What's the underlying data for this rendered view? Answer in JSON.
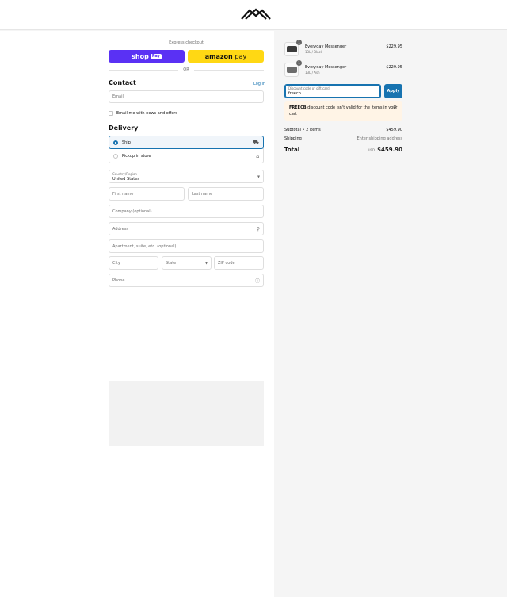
{
  "express": {
    "label": "Express checkout",
    "shop_pay": {
      "brand": "shop",
      "badge": "Pay",
      "color": "#5a31f4"
    },
    "amazon_pay": {
      "brand": "amazon",
      "suffix": "pay",
      "color": "#ffd814"
    },
    "or_label": "OR"
  },
  "contact": {
    "heading": "Contact",
    "login_link": "Log in",
    "email_placeholder": "Email",
    "newsletter_label": "Email me with news and offers"
  },
  "delivery": {
    "heading": "Delivery",
    "options": [
      {
        "label": "Ship",
        "selected": true,
        "icon": "truck-icon"
      },
      {
        "label": "Pickup in store",
        "selected": false,
        "icon": "store-icon"
      }
    ],
    "country_label": "Country/Region",
    "country_value": "United States",
    "first_name_placeholder": "First name",
    "last_name_placeholder": "Last name",
    "company_placeholder": "Company (optional)",
    "address_placeholder": "Address",
    "apartment_placeholder": "Apartment, suite, etc. (optional)",
    "city_placeholder": "City",
    "state_placeholder": "State",
    "zip_placeholder": "ZIP code",
    "phone_placeholder": "Phone"
  },
  "cart": {
    "items": [
      {
        "name": "Everyday Messenger",
        "variant": "13L / Black",
        "price": "$229.95",
        "quantity": "1"
      },
      {
        "name": "Everyday Messenger",
        "variant": "13L / Ash",
        "price": "$229.95",
        "quantity": "1"
      }
    ],
    "discount_label": "Discount code or gift card",
    "discount_value": "freecb",
    "apply_label": "Apply",
    "error_code": "FREECB",
    "error_message": "discount code isn't valid for the items in your cart",
    "subtotal_label": "Subtotal • 2 items",
    "subtotal_value": "$459.90",
    "shipping_label": "Shipping",
    "shipping_value": "Enter shipping address",
    "total_label": "Total",
    "total_currency": "USD",
    "total_value": "$459.90"
  },
  "colors": {
    "accent": "#1773b0",
    "error_bg": "#fff4e6"
  }
}
